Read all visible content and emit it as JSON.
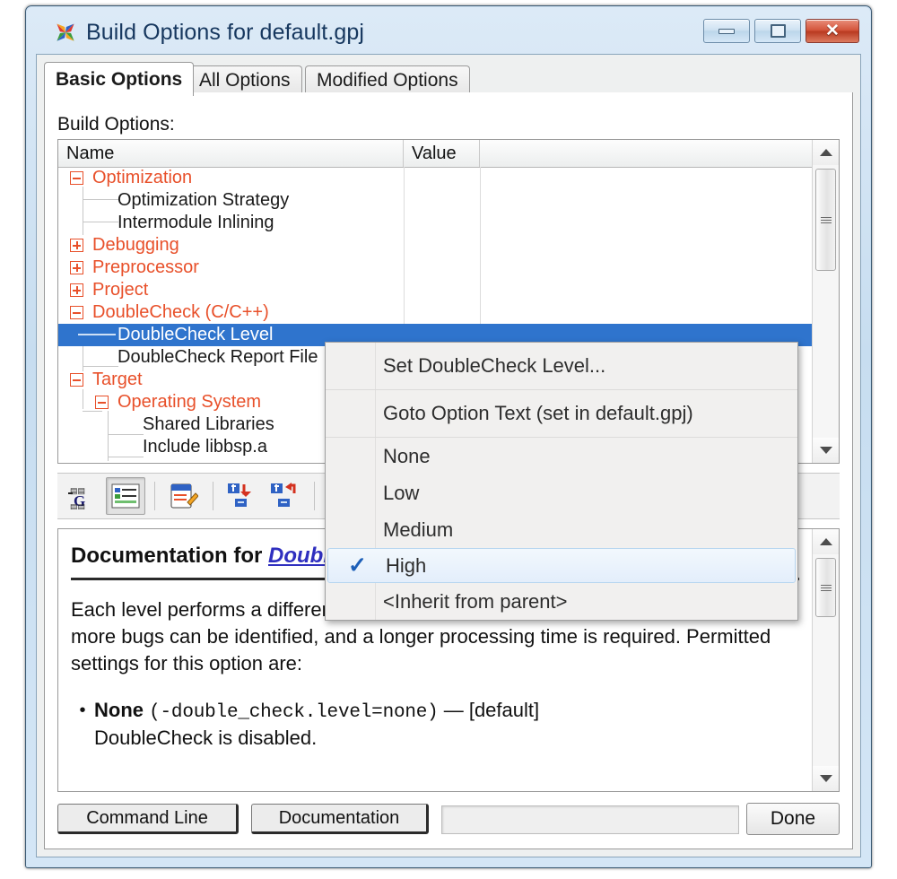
{
  "window": {
    "title": "Build Options for default.gpj",
    "app_icon": "multi-star-icon",
    "minimize_label": "Minimize",
    "maximize_label": "Maximize",
    "close_label": "Close"
  },
  "tabs": [
    {
      "label": "Basic Options",
      "active": true
    },
    {
      "label": "All Options",
      "active": false
    },
    {
      "label": "Modified Options",
      "active": false
    }
  ],
  "build_options": {
    "label": "Build Options:",
    "columns": [
      "Name",
      "Value",
      ""
    ],
    "rows": [
      {
        "label": "Optimization",
        "kind": "category",
        "indent": 0,
        "expander": "minus",
        "selected": false
      },
      {
        "label": "Optimization Strategy",
        "kind": "leaf",
        "indent": 1,
        "expander": "none",
        "selected": false
      },
      {
        "label": "Intermodule Inlining",
        "kind": "leaf",
        "indent": 1,
        "expander": "none",
        "selected": false
      },
      {
        "label": "Debugging",
        "kind": "category",
        "indent": 0,
        "expander": "plus",
        "selected": false
      },
      {
        "label": "Preprocessor",
        "kind": "category",
        "indent": 0,
        "expander": "plus",
        "selected": false
      },
      {
        "label": "Project",
        "kind": "category",
        "indent": 0,
        "expander": "plus",
        "selected": false
      },
      {
        "label": "DoubleCheck (C/C++)",
        "kind": "category",
        "indent": 0,
        "expander": "minus",
        "selected": false
      },
      {
        "label": "DoubleCheck Level",
        "kind": "leaf",
        "indent": 1,
        "expander": "none",
        "selected": true
      },
      {
        "label": "DoubleCheck Report File",
        "kind": "leaf",
        "indent": 1,
        "expander": "none",
        "selected": false
      },
      {
        "label": "Target",
        "kind": "category",
        "indent": 0,
        "expander": "minus",
        "selected": false
      },
      {
        "label": "Operating System",
        "kind": "category",
        "indent": 1,
        "expander": "minus",
        "selected": false
      },
      {
        "label": "Shared Libraries",
        "kind": "leaf",
        "indent": 2,
        "expander": "none",
        "selected": false
      },
      {
        "label": "Include libbsp.a",
        "kind": "leaf",
        "indent": 2,
        "expander": "none",
        "selected": false
      }
    ]
  },
  "toolbar": {
    "buttons": [
      {
        "name": "goto-option-text-icon",
        "pressed": false
      },
      {
        "name": "option-list-view-icon",
        "pressed": true
      },
      {
        "name": "edit-option-icon",
        "pressed": false
      },
      {
        "name": "next-modified-icon",
        "pressed": false
      },
      {
        "name": "previous-modified-icon",
        "pressed": false
      },
      {
        "name": "move-up-icon",
        "pressed": false
      }
    ]
  },
  "context_menu": {
    "items": [
      {
        "label": "Set DoubleCheck Level...",
        "checked": false,
        "highlighted": false,
        "separator_after": true
      },
      {
        "label": "Goto Option Text (set in default.gpj)",
        "checked": false,
        "highlighted": false,
        "separator_after": true
      },
      {
        "label": "None",
        "checked": false,
        "highlighted": false,
        "separator_after": false
      },
      {
        "label": "Low",
        "checked": false,
        "highlighted": false,
        "separator_after": false
      },
      {
        "label": "Medium",
        "checked": false,
        "highlighted": false,
        "separator_after": false
      },
      {
        "label": "High",
        "checked": true,
        "highlighted": true,
        "separator_after": false
      },
      {
        "label": "<Inherit from parent>",
        "checked": false,
        "highlighted": false,
        "separator_after": false
      }
    ],
    "check_glyph": "✓",
    "accent_color": "#1c5fb8"
  },
  "documentation": {
    "heading_prefix": "Documentation for ",
    "heading_link": "DoubleCheck Level",
    "paragraph": "Each level performs a different degree of processing. The higher the level, the more bugs can be identified, and a longer processing time is required. Permitted settings for this option are:",
    "bullet_glyph": "•",
    "items": [
      {
        "term": "None",
        "code": "(-double_check.level=none)",
        "suffix": "— [default]",
        "description": "DoubleCheck is disabled."
      }
    ]
  },
  "bottom_bar": {
    "command_line_label": "Command Line",
    "documentation_label": "Documentation",
    "status_value": "",
    "done_label": "Done"
  },
  "colors": {
    "category_text": "#e8502a",
    "selection": "#2f74cd",
    "link": "#2f2fbf",
    "title_text": "#16375e"
  }
}
